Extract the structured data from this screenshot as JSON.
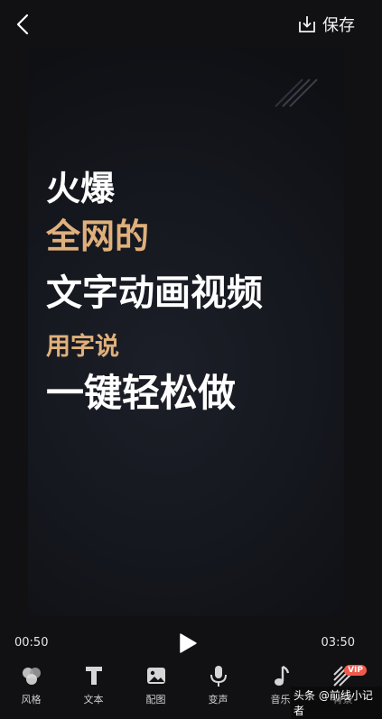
{
  "header": {
    "back_icon": "chevron-left-icon",
    "save_icon": "download-icon",
    "save_label": "保存"
  },
  "preview": {
    "lines": [
      "火爆",
      "全网的",
      "文字动画视频",
      "用字说",
      "一键轻松做"
    ],
    "colors": {
      "white": "#ffffff",
      "gold": "#e0b07c"
    }
  },
  "player": {
    "current_time": "00:50",
    "total_time": "03:50",
    "play_icon": "play-icon"
  },
  "toolbar": {
    "items": [
      {
        "label": "风格",
        "icon": "style-circles-icon"
      },
      {
        "label": "文本",
        "icon": "text-t-icon"
      },
      {
        "label": "配图",
        "icon": "image-icon"
      },
      {
        "label": "变声",
        "icon": "microphone-icon"
      },
      {
        "label": "音乐",
        "icon": "music-note-icon"
      },
      {
        "label": "背景",
        "icon": "background-stripes-icon",
        "badge": "VIP"
      }
    ]
  },
  "watermark": "头条 @前线小记者"
}
